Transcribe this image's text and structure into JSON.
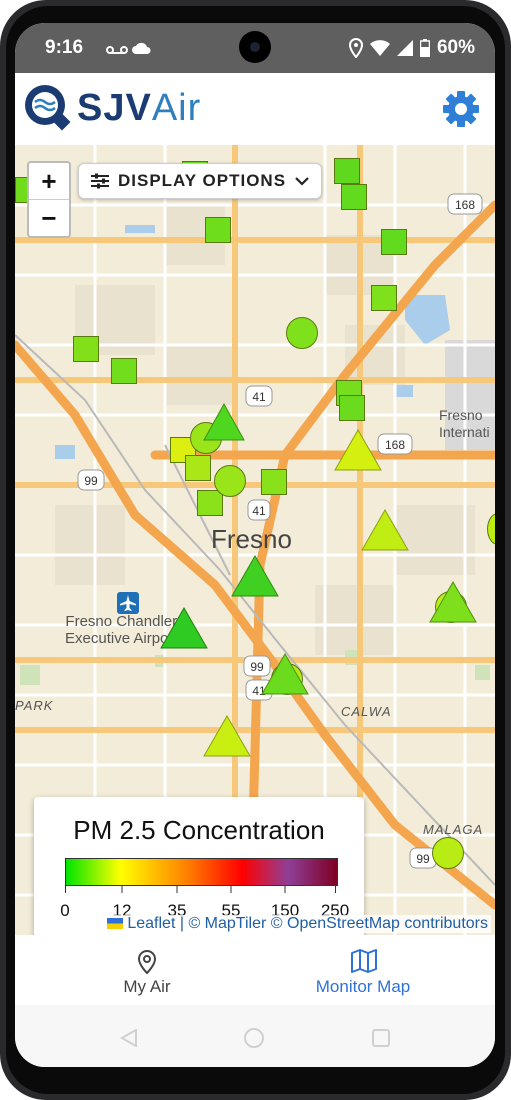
{
  "status_bar": {
    "time": "9:16",
    "battery": "60%"
  },
  "app": {
    "logo_sjv": "SJV",
    "logo_air": "Air"
  },
  "map": {
    "zoom_in": "+",
    "zoom_out": "−",
    "display_options": "DISPLAY OPTIONS",
    "labels": {
      "city": "Fresno",
      "airport": "Fresno Chandler\nExecutive Airport",
      "airport_right": "Fresno\nInternati",
      "calwa": "CALWA",
      "malaga": "MALAGA",
      "park": "PARK"
    },
    "route_shields": [
      "168",
      "41",
      "168",
      "99",
      "41",
      "99",
      "41",
      "99"
    ],
    "attribution": "Leaflet | © MapTiler © OpenStreetMap contributors"
  },
  "legend": {
    "title": "PM 2.5 Concentration",
    "ticks": [
      "0",
      "12",
      "35",
      "55",
      "150",
      "250"
    ]
  },
  "nav": {
    "my_air": "My Air",
    "monitor_map": "Monitor Map"
  },
  "colors": {
    "brand_dark": "#1b3c73",
    "brand_light": "#2f7fbf",
    "nav_active": "#2f72d6",
    "nav_inactive": "#444444",
    "gear": "#2f7fd6"
  }
}
